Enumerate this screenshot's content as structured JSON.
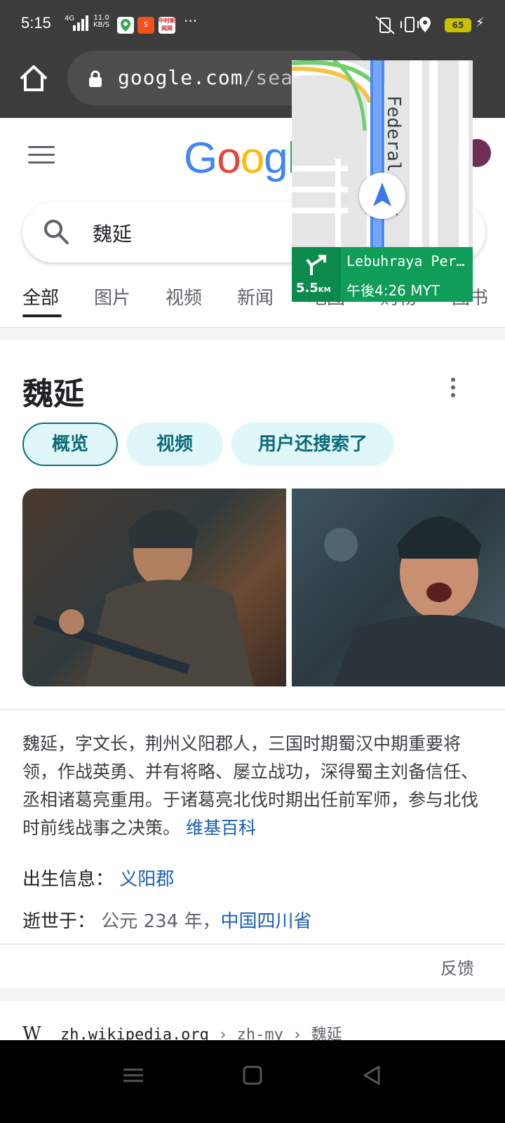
{
  "status_bar": {
    "time": "5:15",
    "network": "4G",
    "speed_value": "11.0",
    "speed_unit": "KB/S",
    "app_badge_label": "中时新闻网",
    "more": "···",
    "battery": "65"
  },
  "browser": {
    "url_host": "google.com",
    "url_path": "/searc"
  },
  "google": {
    "logo": "Google",
    "query": "魏延"
  },
  "tabs": [
    {
      "label": "全部"
    },
    {
      "label": "图片"
    },
    {
      "label": "视频"
    },
    {
      "label": "新闻"
    },
    {
      "label": "地图"
    },
    {
      "label": "购物"
    },
    {
      "label": "图书"
    }
  ],
  "knowledge_panel": {
    "title": "魏延",
    "chips": [
      {
        "label": "概览"
      },
      {
        "label": "视频"
      },
      {
        "label": "用户还搜索了"
      }
    ],
    "description": "魏延，字文长，荆州义阳郡人，三国时期蜀汉中期重要将领，作战英勇、并有将略、屡立战功，深得蜀主刘备信任、丞相诸葛亮重用。于诸葛亮北伐时期出任前军师，参与北伐时前线战事之决策。",
    "source_link": "维基百科",
    "born_label": "出生信息：",
    "born_value": "义阳郡",
    "died_label": "逝世于：",
    "died_value": "公元 234 年，",
    "died_place": "中国四川省",
    "feedback": "反馈"
  },
  "result": {
    "favicon": "W",
    "host": "zh.wikipedia.org",
    "crumb1": " › zh-my",
    "crumb2": " › 魏延"
  },
  "maps_pip": {
    "road_name": "Federal Hwy",
    "distance": "5.5",
    "distance_unit": "KM",
    "street": "Lebuhraya Persekutuan",
    "eta": "午後4:26 MYT"
  },
  "colors": {
    "link": "#1a5fb4",
    "chip_bg": "#e0f7fa",
    "chip_text": "#0d6b79",
    "nav_green": "#0f9d58"
  }
}
